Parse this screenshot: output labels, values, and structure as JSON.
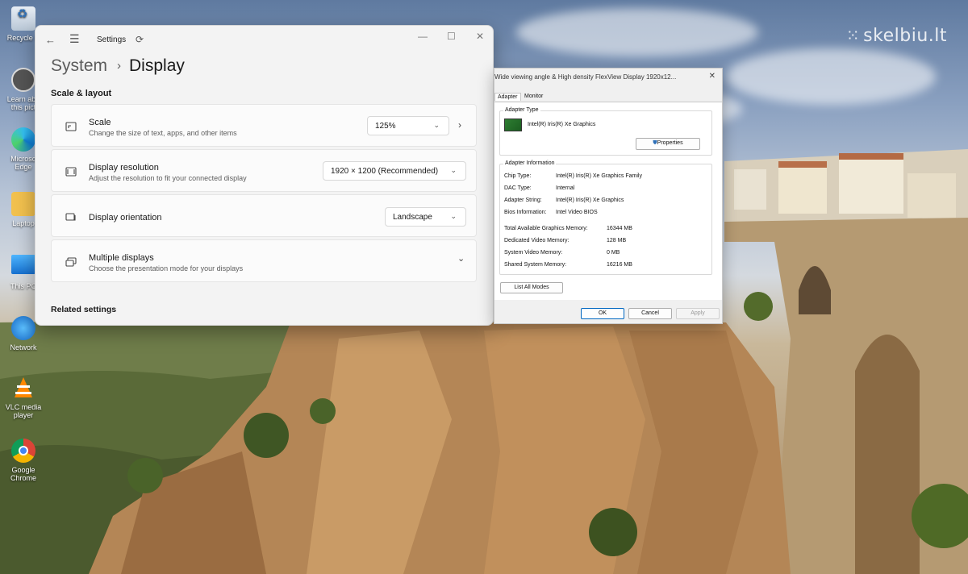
{
  "watermark": {
    "text": "skelbiu.lt"
  },
  "desktop": {
    "icons": [
      {
        "label": "Recycle B",
        "icon": "recycle-bin-icon"
      },
      {
        "label": "Learn abo this pict",
        "icon": "learn-about-picture-icon"
      },
      {
        "label": "Microso Edge",
        "icon": "edge-icon"
      },
      {
        "label": "Laptop",
        "icon": "folder-icon"
      },
      {
        "label": "This PC",
        "icon": "computer-icon"
      },
      {
        "label": "Network",
        "icon": "network-icon"
      },
      {
        "label": "VLC media player",
        "icon": "vlc-icon"
      },
      {
        "label": "Google Chrome",
        "icon": "chrome-icon"
      }
    ]
  },
  "settings": {
    "app_name": "Settings",
    "breadcrumb": {
      "parent": "System",
      "separator": "›",
      "current": "Display"
    },
    "section_scale": "Scale & layout",
    "items": [
      {
        "title": "Scale",
        "desc": "Change the size of text, apps, and other items",
        "value": "125%",
        "icon": "scale-icon"
      },
      {
        "title": "Display resolution",
        "desc": "Adjust the resolution to fit your connected display",
        "value": "1920 × 1200 (Recommended)",
        "icon": "resolution-icon"
      },
      {
        "title": "Display orientation",
        "desc": "",
        "value": "Landscape",
        "icon": "orientation-icon"
      },
      {
        "title": "Multiple displays",
        "desc": "Choose the presentation mode for your displays",
        "value": "",
        "icon": "multiple-displays-icon"
      }
    ],
    "section_related": "Related settings",
    "window_controls": {
      "minimize": "—",
      "maximize": "☐",
      "close": "✕"
    }
  },
  "dialog": {
    "title": "Wide viewing angle & High density FlexView Display 1920x12...",
    "close": "✕",
    "tabs": [
      "Adapter",
      "Monitor"
    ],
    "adapter_type": {
      "label": "Adapter Type",
      "name": "Intel(R) Iris(R) Xe Graphics",
      "properties_button": "Properties"
    },
    "adapter_info": {
      "label": "Adapter Information",
      "rows": [
        {
          "k": "Chip Type:",
          "v": "Intel(R) Iris(R) Xe Graphics Family"
        },
        {
          "k": "DAC Type:",
          "v": "Internal"
        },
        {
          "k": "Adapter String:",
          "v": "Intel(R) Iris(R) Xe Graphics"
        },
        {
          "k": "Bios Information:",
          "v": "Intel Video BIOS"
        }
      ],
      "memory_rows": [
        {
          "k": "Total Available Graphics Memory:",
          "v": "16344 MB"
        },
        {
          "k": "Dedicated Video Memory:",
          "v": "128 MB"
        },
        {
          "k": "System Video Memory:",
          "v": "0 MB"
        },
        {
          "k": "Shared System Memory:",
          "v": "16216 MB"
        }
      ]
    },
    "list_all_modes": "List All Modes",
    "buttons": {
      "ok": "OK",
      "cancel": "Cancel",
      "apply": "Apply"
    }
  }
}
